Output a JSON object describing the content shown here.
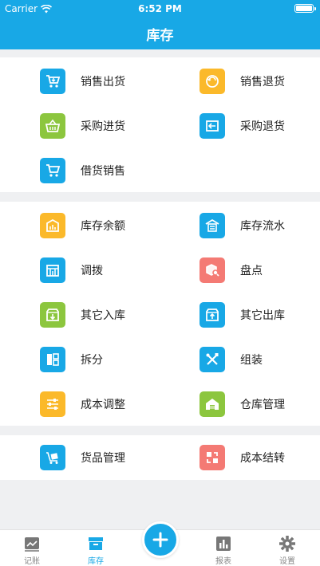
{
  "status": {
    "carrier": "Carrier",
    "time": "6:52 PM"
  },
  "header": {
    "title": "库存"
  },
  "sections": [
    {
      "items": [
        {
          "label": "销售出货",
          "icon": "cart-out-icon",
          "color": "#18a8e6"
        },
        {
          "label": "销售退货",
          "icon": "return-icon",
          "color": "#fbb92a"
        },
        {
          "label": "采购进货",
          "icon": "basket-icon",
          "color": "#8cc63e"
        },
        {
          "label": "采购退货",
          "icon": "box-arrow-icon",
          "color": "#18a8e6"
        },
        {
          "label": "借货销售",
          "icon": "cart-icon",
          "color": "#18a8e6"
        }
      ]
    },
    {
      "items": [
        {
          "label": "库存余额",
          "icon": "inventory-icon",
          "color": "#fbb92a"
        },
        {
          "label": "库存流水",
          "icon": "warehouse-flow-icon",
          "color": "#18a8e6"
        },
        {
          "label": "调拨",
          "icon": "transfer-icon",
          "color": "#18a8e6"
        },
        {
          "label": "盘点",
          "icon": "stocktake-icon",
          "color": "#f47a74"
        },
        {
          "label": "其它入库",
          "icon": "inbound-icon",
          "color": "#8cc63e"
        },
        {
          "label": "其它出库",
          "icon": "outbound-icon",
          "color": "#18a8e6"
        },
        {
          "label": "拆分",
          "icon": "split-icon",
          "color": "#18a8e6"
        },
        {
          "label": "组装",
          "icon": "tools-icon",
          "color": "#18a8e6"
        },
        {
          "label": "成本调整",
          "icon": "sliders-icon",
          "color": "#fbb92a"
        },
        {
          "label": "仓库管理",
          "icon": "warehouse-icon",
          "color": "#8cc63e"
        }
      ]
    },
    {
      "items": [
        {
          "label": "货品管理",
          "icon": "goods-icon",
          "color": "#18a8e6"
        },
        {
          "label": "成本结转",
          "icon": "carryover-icon",
          "color": "#f47a74"
        }
      ]
    }
  ],
  "tabbar": {
    "tabs": [
      {
        "label": "记账",
        "icon": "chart-line-icon"
      },
      {
        "label": "库存",
        "icon": "archive-box-icon"
      },
      {
        "label": "报表",
        "icon": "bar-chart-icon"
      },
      {
        "label": "设置",
        "icon": "gear-icon"
      }
    ],
    "active": "库存"
  },
  "colors": {
    "accent": "#18a8e6",
    "orange": "#fbb92a",
    "green": "#8cc63e",
    "red": "#f47a74"
  }
}
